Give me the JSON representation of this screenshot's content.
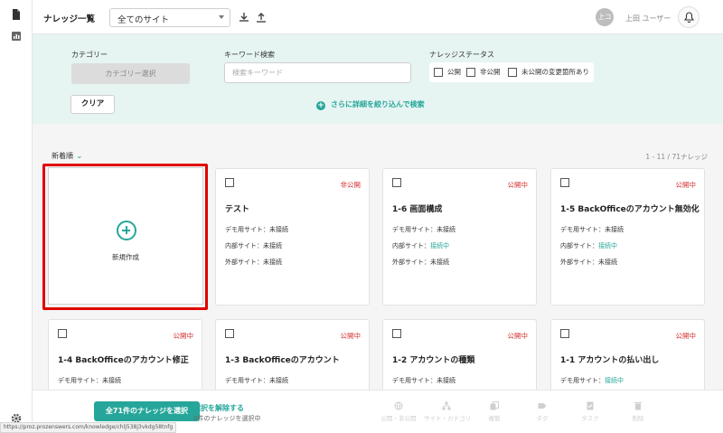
{
  "header": {
    "title": "ナレッジ一覧",
    "site_select": "全てのサイト",
    "avatar": "上コ",
    "username": "上田 ユーザー"
  },
  "filter": {
    "category_label": "カテゴリー",
    "category_button": "カテゴリー選択",
    "keyword_label": "キーワード検索",
    "keyword_placeholder": "検索キーワード",
    "status_label": "ナレッジステータス",
    "status_options": [
      "公開",
      "非公開",
      "未公開の変更箇所あり"
    ],
    "clear_button": "クリア",
    "advanced_search": "さらに詳細を絞り込んで検索"
  },
  "list": {
    "sort_label": "新着順",
    "count": "1 - 11 / 71ナレッジ",
    "new_card_label": "新規作成",
    "cards": [
      {
        "title": "テスト",
        "status": "非公開",
        "rows": [
          {
            "label": "デモ用サイト：",
            "value": "未接続"
          },
          {
            "label": "内部サイト：",
            "value": "未接続"
          },
          {
            "label": "外部サイト：",
            "value": "未接続"
          }
        ]
      },
      {
        "title": "1-6 画面構成",
        "status": "公開中",
        "rows": [
          {
            "label": "デモ用サイト：",
            "value": "未接続"
          },
          {
            "label": "内部サイト：",
            "value": "接続中"
          },
          {
            "label": "外部サイト：",
            "value": "未接続"
          }
        ]
      },
      {
        "title": "1-5 BackOfficeのアカウント無効化",
        "status": "公開中",
        "rows": [
          {
            "label": "デモ用サイト：",
            "value": "未接続"
          },
          {
            "label": "内部サイト：",
            "value": "接続中"
          },
          {
            "label": "外部サイト：",
            "value": "未接続"
          }
        ]
      },
      {
        "title": "1-4 BackOfficeのアカウント修正",
        "status": "公開中",
        "rows": [
          {
            "label": "デモ用サイト：",
            "value": "未接続"
          }
        ]
      },
      {
        "title": "1-3 BackOfficeのアカウント",
        "status": "公開中",
        "rows": [
          {
            "label": "デモ用サイト：",
            "value": "未接続"
          }
        ]
      },
      {
        "title": "1-2 アカウントの種類",
        "status": "公開中",
        "rows": [
          {
            "label": "デモ用サイト：",
            "value": "未接続"
          }
        ]
      },
      {
        "title": "1-1 アカウントの払い出し",
        "status": "公開中",
        "rows": [
          {
            "label": "デモ用サイト：",
            "value": "接続中"
          }
        ]
      }
    ]
  },
  "bottombar": {
    "select_all": "全71件のナレッジを選択",
    "deselect": "選択を解除する",
    "selected_count": "0件のナレッジを選択中",
    "actions": [
      {
        "icon": "globe-icon",
        "label": "公開・非公開"
      },
      {
        "icon": "hierarchy-icon",
        "label": "サイト・カテゴリ"
      },
      {
        "icon": "copy-icon",
        "label": "複製"
      },
      {
        "icon": "tag-icon",
        "label": "タグ"
      },
      {
        "icon": "task-icon",
        "label": "タスク"
      },
      {
        "icon": "trash-icon",
        "label": "削除"
      }
    ]
  },
  "status_url": "https://proz.prozenswers.com/knowledge/chlj538j3vkdg58tnfg",
  "colors": {
    "accent": "#26a69a",
    "status_red": "#d32f2f",
    "highlight": "#e00000",
    "filter_bg": "#e6f4f2"
  }
}
